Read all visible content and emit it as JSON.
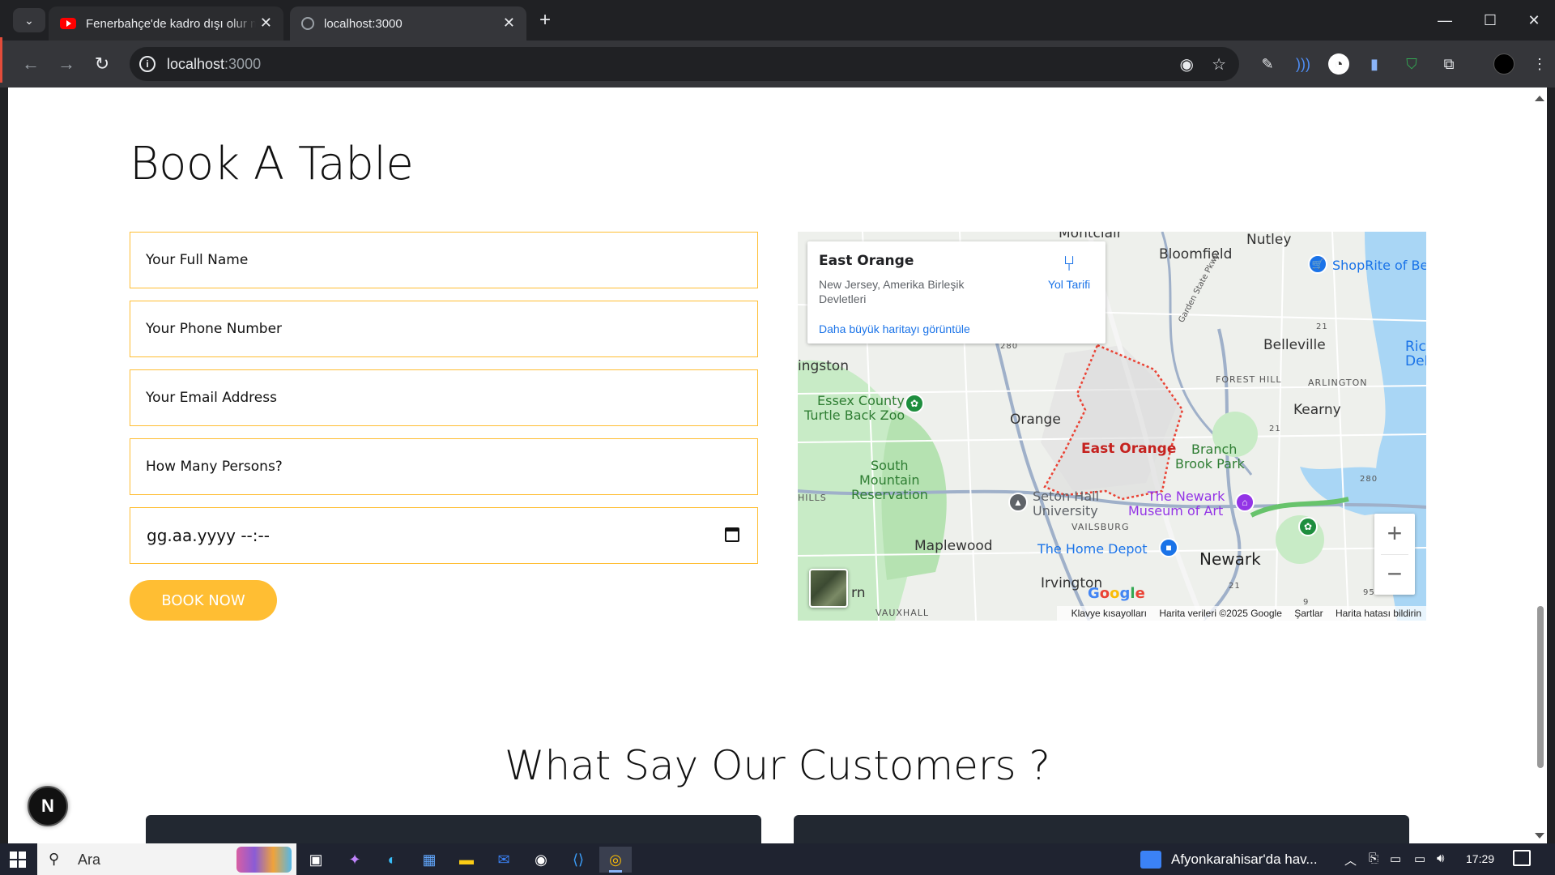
{
  "browser": {
    "tabs": [
      {
        "title": "Fenerbahçe'de kadro dışı olur mu?",
        "active": false
      },
      {
        "title": "localhost:3000",
        "active": true
      }
    ],
    "url_host": "localhost",
    "url_port": ":3000"
  },
  "page": {
    "book_title": "Book A Table",
    "form": {
      "name_placeholder": "Your Full Name",
      "phone_placeholder": "Your Phone Number",
      "email_placeholder": "Your Email Address",
      "persons_placeholder": "How Many Persons?",
      "datetime_value": "gg.aa.yyyy --:--",
      "submit_label": "BOOK NOW"
    },
    "map": {
      "card_title": "East Orange",
      "card_address": "New Jersey, Amerika Birleşik Devletleri",
      "card_link": "Daha büyük haritayı görüntüle",
      "directions_label": "Yol Tarifi",
      "labels": {
        "montclair": "Montclair",
        "nutley": "Nutley",
        "bloomfield": "Bloomfield",
        "shoprite": "ShopRite of Bel",
        "belleville": "Belleville",
        "livingston": "ingston",
        "forest_hill": "FOREST HILL",
        "arlington": "ARLINGTON",
        "ric": "Ric",
        "deko": "DeKo",
        "zoo_line1": "Essex County",
        "zoo_line2": "Turtle Back Zoo",
        "orange": "Orange",
        "kearny": "Kearny",
        "east_orange": "East Orange",
        "branch_line1": "Branch",
        "branch_line2": "Brook Park",
        "south_mountain_line1": "South",
        "south_mountain_line2": "Mountain",
        "south_mountain_line3": "Reservation",
        "hills": "HILLS",
        "seton_line1": "Seton Hall",
        "seton_line2": "University",
        "newark_museum_line1": "The Newark",
        "newark_museum_line2": "Museum of Art",
        "vailsburg": "VAILSBURG",
        "maplewood": "Maplewood",
        "home_depot": "The Home Depot",
        "newark": "Newark",
        "irvington": "Irvington",
        "rn": "rn",
        "vauxhall": "VAUXHALL",
        "parkway": "Garden State Pkwy",
        "r21a": "21",
        "r21b": "21",
        "r21c": "21",
        "r280a": "280",
        "r280b": "280",
        "r95": "95",
        "r9": "9"
      },
      "google": "Google",
      "attribution": {
        "shortcuts": "Klavye kısayolları",
        "data": "Harita verileri ©2025 Google",
        "terms": "Şartlar",
        "report": "Harita hatası bildirin"
      },
      "zoom_in": "+",
      "zoom_out": "−"
    },
    "customers_title": "What Say Our Customers ?",
    "dev_badge": "N"
  },
  "taskbar": {
    "search_label": "Ara",
    "news": "Afyonkarahisar'da hav...",
    "time": "17:29"
  },
  "colors": {
    "accent": "#ffbe33",
    "card_dark": "#222831"
  }
}
